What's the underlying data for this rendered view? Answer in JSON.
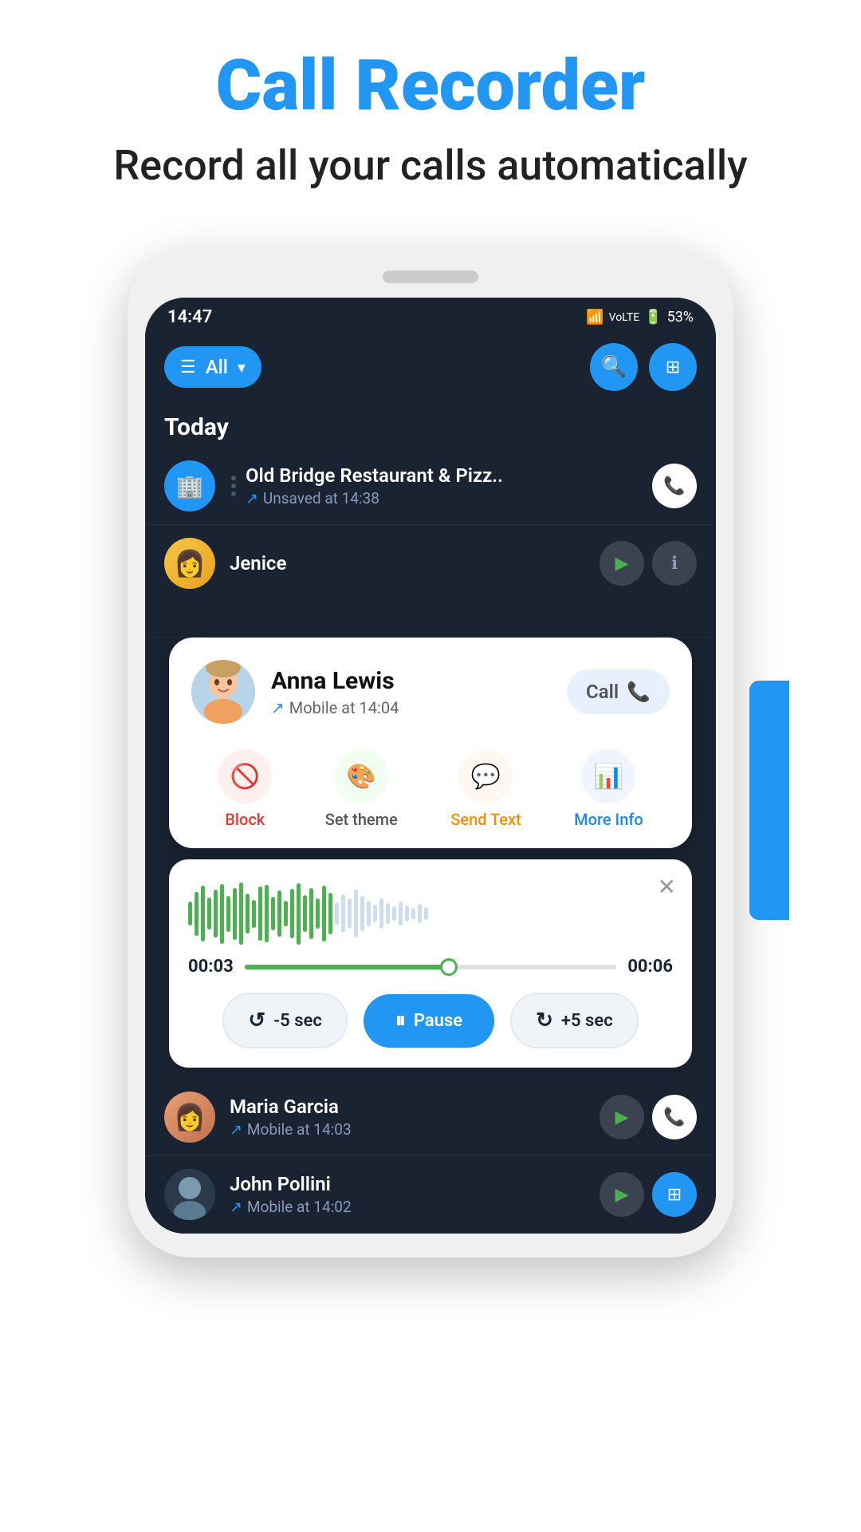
{
  "header": {
    "title": "Call Recorder",
    "subtitle": "Record all your calls automatically"
  },
  "status_bar": {
    "time": "14:47",
    "battery": "53%",
    "icons": "📶 Vol LTE 📷"
  },
  "app_bar": {
    "filter_label": "All",
    "filter_icon": "☰"
  },
  "section": {
    "today_label": "Today"
  },
  "calls": [
    {
      "name": "Old Bridge Restaurant & Pizz..",
      "detail": "Unsaved at 14:38",
      "type": "building",
      "outgoing": true
    },
    {
      "name": "Jenice",
      "detail": "",
      "type": "person",
      "outgoing": false
    }
  ],
  "contact_card": {
    "name": "Anna Lewis",
    "detail": "Mobile at 14:04",
    "call_btn_label": "Call",
    "outgoing": true
  },
  "action_buttons": [
    {
      "label": "Block",
      "color": "red",
      "icon": "🚫"
    },
    {
      "label": "Set theme",
      "color": "green",
      "icon": "🎨"
    },
    {
      "label": "Send Text",
      "color": "orange",
      "icon": "💬"
    },
    {
      "label": "More Info",
      "color": "blue",
      "icon": "📊"
    }
  ],
  "player": {
    "current_time": "00:03",
    "total_time": "00:06",
    "progress_percent": 55,
    "close_icon": "✕",
    "controls": {
      "rewind_label": "-5 sec",
      "pause_label": "Pause",
      "forward_label": "+5 sec"
    }
  },
  "bottom_calls": [
    {
      "name": "Maria Garcia",
      "detail": "Mobile at 14:03",
      "outgoing": true
    },
    {
      "name": "John Pollini",
      "detail": "Mobile at 14:02",
      "outgoing": true
    }
  ],
  "icons": {
    "search": "🔍",
    "grid": "⊞",
    "phone": "📞",
    "play": "▶",
    "pause": "⏸",
    "arrow_out": "↗",
    "rewind": "↺",
    "forward": "↻"
  }
}
